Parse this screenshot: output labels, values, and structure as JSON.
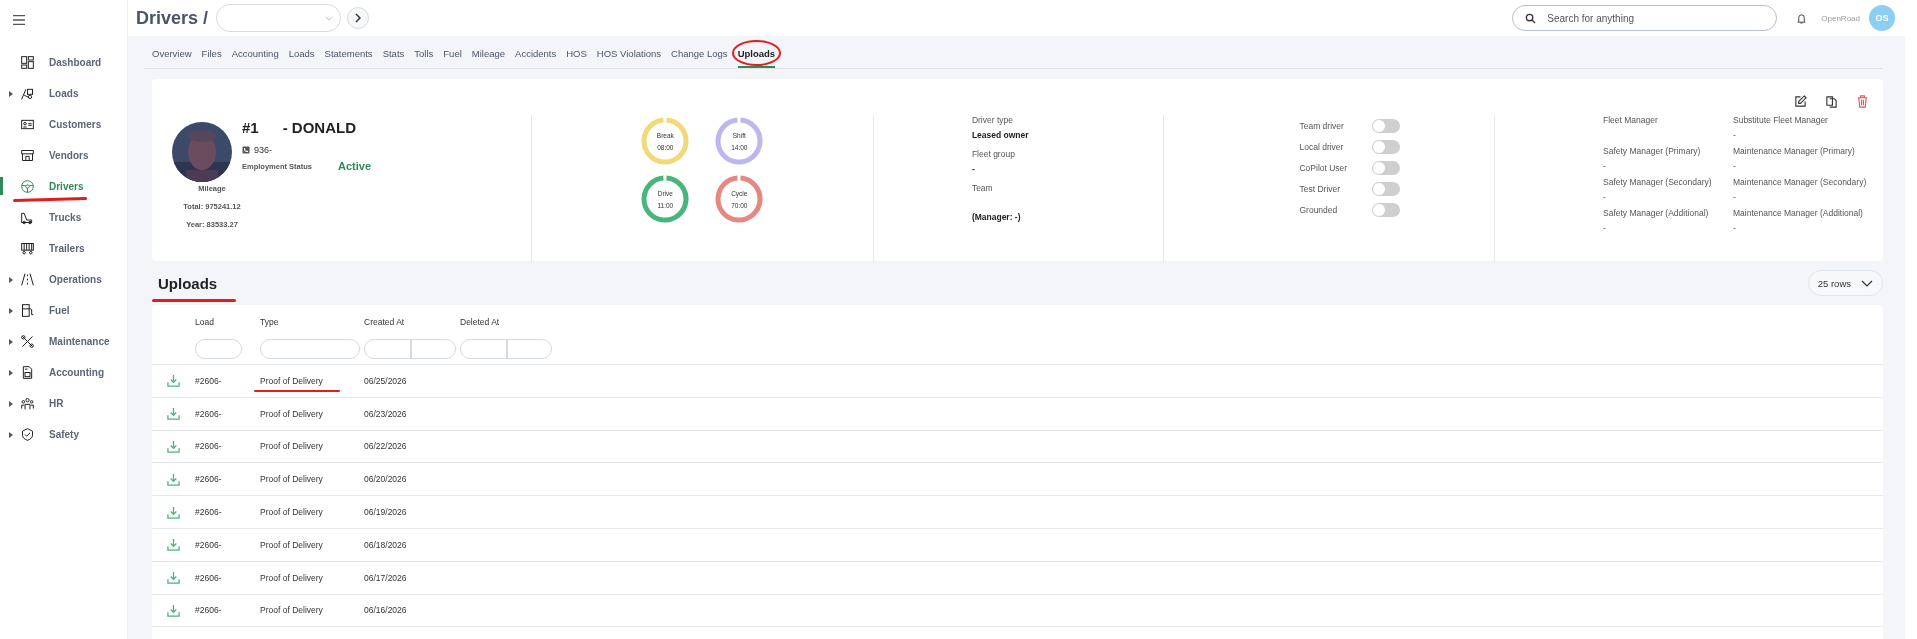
{
  "sidebar": {
    "items": [
      {
        "label": "Dashboard",
        "expandable": false,
        "selected": false,
        "marked": false
      },
      {
        "label": "Loads",
        "expandable": true,
        "selected": false,
        "marked": false
      },
      {
        "label": "Customers",
        "expandable": false,
        "selected": false,
        "marked": false
      },
      {
        "label": "Vendors",
        "expandable": false,
        "selected": false,
        "marked": false
      },
      {
        "label": "Drivers",
        "expandable": false,
        "selected": true,
        "marked": true
      },
      {
        "label": "Trucks",
        "expandable": false,
        "selected": false,
        "marked": false
      },
      {
        "label": "Trailers",
        "expandable": false,
        "selected": false,
        "marked": false
      },
      {
        "label": "Operations",
        "expandable": true,
        "selected": false,
        "marked": false
      },
      {
        "label": "Fuel",
        "expandable": true,
        "selected": false,
        "marked": false
      },
      {
        "label": "Maintenance",
        "expandable": true,
        "selected": false,
        "marked": false
      },
      {
        "label": "Accounting",
        "expandable": true,
        "selected": false,
        "marked": false
      },
      {
        "label": "HR",
        "expandable": true,
        "selected": false,
        "marked": false
      },
      {
        "label": "Safety",
        "expandable": true,
        "selected": false,
        "marked": false
      }
    ]
  },
  "header": {
    "breadcrumb": "Drivers /",
    "search": {
      "placeholder": "Search for anything"
    },
    "company": "OpenRoad",
    "avatar": "OS"
  },
  "tabs": [
    {
      "label": "Overview",
      "selected": false,
      "marked": false
    },
    {
      "label": "Files",
      "selected": false,
      "marked": false
    },
    {
      "label": "Accounting",
      "selected": false,
      "marked": false
    },
    {
      "label": "Loads",
      "selected": false,
      "marked": false
    },
    {
      "label": "Statements",
      "selected": false,
      "marked": false
    },
    {
      "label": "Stats",
      "selected": false,
      "marked": false
    },
    {
      "label": "Tolls",
      "selected": false,
      "marked": false
    },
    {
      "label": "Fuel",
      "selected": false,
      "marked": false
    },
    {
      "label": "Mileage",
      "selected": false,
      "marked": false
    },
    {
      "label": "Accidents",
      "selected": false,
      "marked": false
    },
    {
      "label": "HOS",
      "selected": false,
      "marked": false
    },
    {
      "label": "HOS Violations",
      "selected": false,
      "marked": false
    },
    {
      "label": "Change Logs",
      "selected": false,
      "marked": false
    },
    {
      "label": "Uploads",
      "selected": true,
      "marked": true
    }
  ],
  "driver": {
    "number": "#1",
    "name": "- DONALD",
    "phone": "936-",
    "employment_status": {
      "label": "Employment Status",
      "value": "Active"
    },
    "mileage": {
      "label": "Mileage",
      "total": "Total: 975241.12",
      "year": "Year: 83533.27"
    },
    "timers": [
      {
        "label": "Break",
        "value": "08:00",
        "color": "#f2d978"
      },
      {
        "label": "Shift",
        "value": "14:00",
        "color": "#bcb8ee"
      },
      {
        "label": "Drive",
        "value": "11:00",
        "color": "#48b57c"
      },
      {
        "label": "Cycle",
        "value": "70:00",
        "color": "#e58882"
      }
    ],
    "details": [
      {
        "label": "Driver type",
        "value": "Leased owner"
      },
      {
        "label": "Fleet group",
        "value": "-"
      },
      {
        "label": "Team",
        "value": "(Manager: -)"
      }
    ],
    "toggles": [
      {
        "label": "Team driver",
        "on": false
      },
      {
        "label": "Local driver",
        "on": false
      },
      {
        "label": "CoPilot User",
        "on": false
      },
      {
        "label": "Test Driver",
        "on": false
      },
      {
        "label": "Grounded",
        "on": false
      }
    ],
    "managers": [
      {
        "label": "Fleet Manager"
      },
      {
        "label": "Substitute Fleet Manager",
        "value": "-"
      },
      {
        "label": "Safety Manager (Primary)",
        "value": "-"
      },
      {
        "label": "Maintenance Manager (Primary)",
        "value": "-"
      },
      {
        "label": "Safety Manager (Secondary)",
        "value": "-"
      },
      {
        "label": "Maintenance Manager (Secondary)",
        "value": "-"
      },
      {
        "label": "Safety Manager (Additional)",
        "value": "-"
      },
      {
        "label": "Maintenance Manager (Additional)",
        "value": "-"
      }
    ]
  },
  "uploads": {
    "title": "Uploads",
    "title_marked": true,
    "rows_select": "25 rows",
    "columns": [
      {
        "label": "Load",
        "kind": "single"
      },
      {
        "label": "Type",
        "kind": "single"
      },
      {
        "label": "Created At",
        "kind": "range"
      },
      {
        "label": "Deleted At",
        "kind": "range"
      }
    ],
    "rows": [
      {
        "load": "#2606-",
        "type": "Proof of Delivery",
        "created_at": "06/25/2026",
        "marked": true
      },
      {
        "load": "#2606-",
        "type": "Proof of Delivery",
        "created_at": "06/23/2026",
        "marked": false
      },
      {
        "load": "#2606-",
        "type": "Proof of Delivery",
        "created_at": "06/22/2026",
        "marked": false
      },
      {
        "load": "#2606-",
        "type": "Proof of Delivery",
        "created_at": "06/20/2026",
        "marked": false
      },
      {
        "load": "#2606-",
        "type": "Proof of Delivery",
        "created_at": "06/19/2026",
        "marked": false
      },
      {
        "load": "#2606-",
        "type": "Proof of Delivery",
        "created_at": "06/18/2026",
        "marked": false
      },
      {
        "load": "#2606-",
        "type": "Proof of Delivery",
        "created_at": "06/17/2026",
        "marked": false
      },
      {
        "load": "#2606-",
        "type": "Proof of Delivery",
        "created_at": "06/16/2026",
        "marked": false
      }
    ]
  }
}
